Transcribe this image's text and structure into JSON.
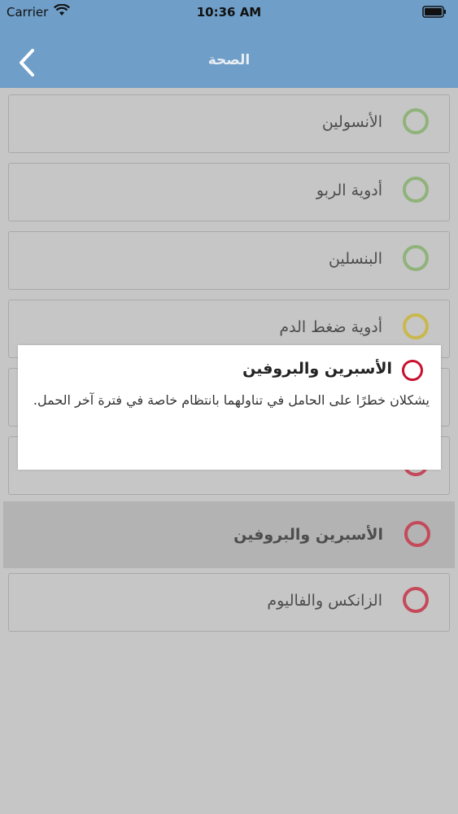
{
  "status_bar": {
    "carrier": "Carrier",
    "time": "10:36 AM"
  },
  "nav": {
    "title": "الصحة",
    "back_icon": "chevron-left-icon"
  },
  "list": {
    "items": [
      {
        "label": "الأنسولين",
        "circle_color": "#8fb37a"
      },
      {
        "label": "أدوية الربو",
        "circle_color": "#8fb37a"
      },
      {
        "label": "البنسلين",
        "circle_color": "#8fb37a"
      },
      {
        "label": "أدوية ضغط الدم",
        "circle_color": "#c9b84d"
      },
      {
        "label": "",
        "circle_color": "#c44a5a"
      },
      {
        "label": "",
        "circle_color": "#c44a5a"
      },
      {
        "label": "الأسبرين والبروفين",
        "circle_color": "#c44a5a"
      },
      {
        "label": "الزانكس والفاليوم",
        "circle_color": "#c44a5a"
      }
    ]
  },
  "popup": {
    "title": "الأسبرين والبروفين",
    "body": "يشكلان خطرًا على الحامل في تناولهما بانتظام خاصة في فترة آخر الحمل.",
    "circle_color": "#c8102e"
  }
}
